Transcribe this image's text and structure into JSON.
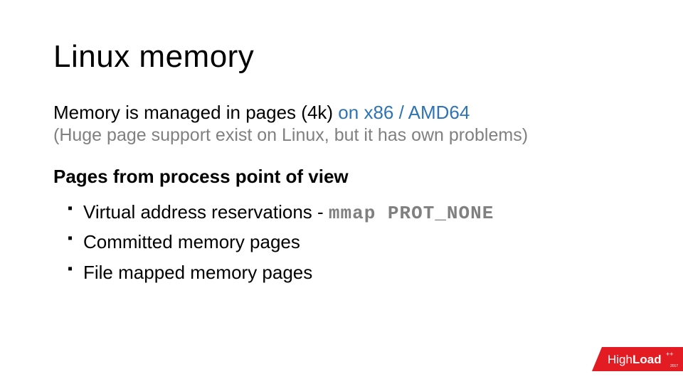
{
  "title": "Linux memory",
  "intro": {
    "prefix": "Memory is managed in pages (4k) ",
    "arch": "on x86 / AMD64",
    "note": "(Huge page support exist on Linux, but it has own problems)"
  },
  "subhead": "Pages from process point of view",
  "bullets": [
    {
      "text_prefix": "Virtual address reservations - ",
      "mono": "mmap PROT_NONE"
    },
    {
      "text_prefix": "Committed memory pages",
      "mono": ""
    },
    {
      "text_prefix": "File mapped memory pages",
      "mono": ""
    }
  ],
  "logo": {
    "light": "High",
    "bold": "Load",
    "plus": "++",
    "year": "2017"
  }
}
